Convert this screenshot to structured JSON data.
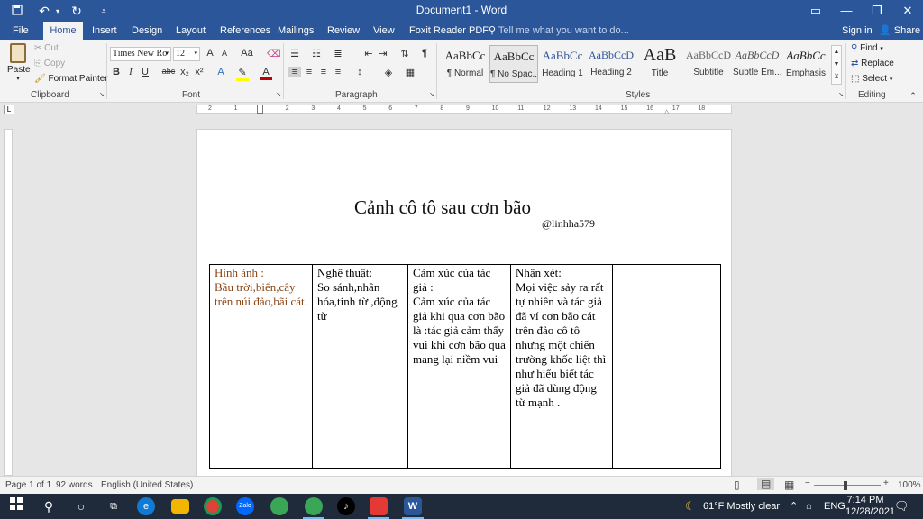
{
  "window": {
    "title": "Document1 - Word",
    "quick_access": {
      "save_icon": "save-icon",
      "undo_icon": "undo-icon",
      "redo_icon": "redo-icon",
      "customize_icon": "customize-icon"
    },
    "controls": {
      "ribbon_display": "▭",
      "minimize": "—",
      "restore": "❐",
      "close": "✕"
    },
    "colors": {
      "word_blue": "#2b579a"
    }
  },
  "tabs": [
    "File",
    "Home",
    "Insert",
    "Design",
    "Layout",
    "References",
    "Mailings",
    "Review",
    "View",
    "Foxit Reader PDF"
  ],
  "tell_me": "Tell me what you want to do...",
  "account": {
    "sign_in": "Sign in",
    "share": "Share"
  },
  "ribbon": {
    "clipboard": {
      "label": "Clipboard",
      "paste": "Paste",
      "cut": "Cut",
      "copy": "Copy",
      "format_painter": "Format Painter"
    },
    "font": {
      "label": "Font",
      "font_name": "Times New Ro",
      "font_size": "12",
      "bold": "B",
      "italic": "I",
      "underline": "U",
      "strike": "abc",
      "subscript": "x₂",
      "superscript": "x²",
      "grow": "A",
      "shrink": "A",
      "case": "Aa",
      "text_effects": "A",
      "font_color": "A"
    },
    "paragraph": {
      "label": "Paragraph",
      "pilcrow": "¶"
    },
    "styles": {
      "label": "Styles",
      "items": [
        {
          "sample": "AaBbCc",
          "name": "¶ Normal"
        },
        {
          "sample": "AaBbCc",
          "name": "¶ No Spac..."
        },
        {
          "sample": "AaBbCc",
          "name": "Heading 1"
        },
        {
          "sample": "AaBbCcD",
          "name": "Heading 2"
        },
        {
          "sample": "AaB",
          "name": "Title"
        },
        {
          "sample": "AaBbCcD",
          "name": "Subtitle"
        },
        {
          "sample": "AaBbCcD",
          "name": "Subtle Em..."
        },
        {
          "sample": "AaBbCc",
          "name": "Emphasis"
        }
      ]
    },
    "editing": {
      "label": "Editing",
      "find": "Find",
      "replace": "Replace",
      "select": "Select"
    }
  },
  "ruler": {
    "tab_selector": "L",
    "marks": [
      "2",
      "1",
      "1",
      "2",
      "3",
      "4",
      "5",
      "6",
      "7",
      "8",
      "9",
      "10",
      "11",
      "12",
      "13",
      "14",
      "15",
      "16",
      "17",
      "18"
    ]
  },
  "document": {
    "title": "Cảnh cô tô sau cơn bão",
    "author": "@linhha579",
    "table": [
      {
        "heading": "Hình ảnh :",
        "body": "Bầu trời,biển,cây trên núi đảo,bãi cát."
      },
      {
        "heading": "Nghệ thuật:",
        "body": "So sánh,nhân hóa,tính từ ,động từ"
      },
      {
        "heading": "Cảm xúc của tác giả :",
        "body": "Cảm xúc của tác giả khi qua cơn bão là :tác giả cảm thấy vui khi cơn bão qua mang lại niềm vui"
      },
      {
        "heading": "Nhận xét:",
        "body": "Mọi việc sảy ra rất tự nhiên và tác giả đã ví cơn bão cát trên đảo cô tô nhưng một chiến trường khốc liệt thì như hiểu biết tác giả đã dùng động từ mạnh ."
      },
      {
        "heading": "",
        "body": ""
      }
    ],
    "highlight_color": "#8b4513"
  },
  "status": {
    "page": "Page 1 of 1",
    "words": "92 words",
    "language": "English (United States)",
    "zoom": "100%",
    "zoom_minus": "−",
    "zoom_plus": "+"
  },
  "taskbar": {
    "apps": [
      "windows-icon",
      "search-icon",
      "cortana-icon",
      "task-view-icon",
      "edge-icon",
      "file-explorer-icon",
      "chrome-icon",
      "zalo-icon",
      "app-icon",
      "app-icon",
      "tiktok-icon",
      "app-icon",
      "word-icon"
    ],
    "zalo_text": "Zalo",
    "weather": "61°F  Mostly clear",
    "lang": "ENG",
    "time": "7:14 PM",
    "date": "12/28/2021"
  }
}
